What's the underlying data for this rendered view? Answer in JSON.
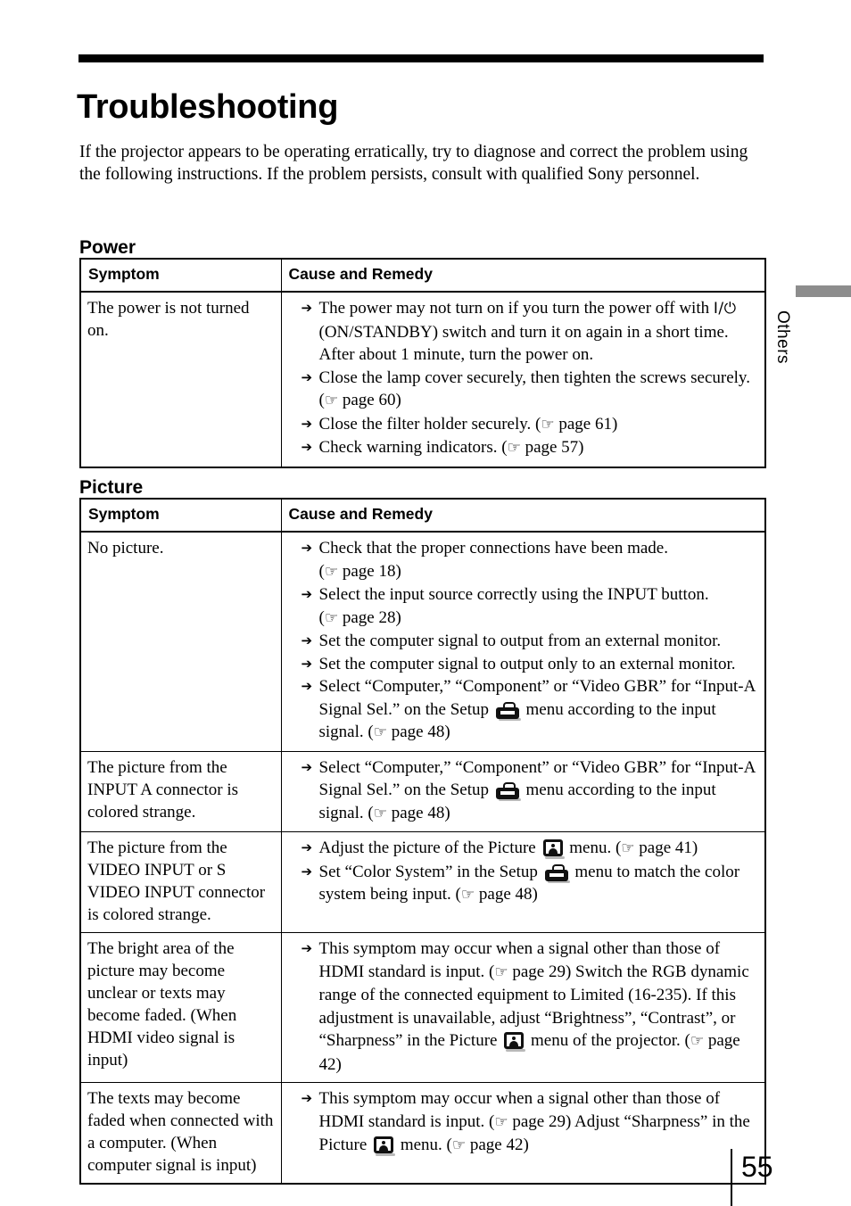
{
  "document": {
    "title": "Troubleshooting",
    "intro": "If the projector appears to be operating erratically, try to diagnose and correct the problem using the following instructions. If the problem persists, consult with qualified Sony personnel.",
    "page_number": "55",
    "side_tab": "Others"
  },
  "table_headers": {
    "symptom": "Symptom",
    "cause_and_remedy": "Cause and Remedy"
  },
  "sections": [
    {
      "heading": "Power",
      "rows": [
        {
          "symptom": "The power is not turned on.",
          "remedies": [
            {
              "parts": [
                {
                  "t": "text",
                  "v": "The power may not turn on if you turn the power off with "
                },
                {
                  "t": "power-symbol",
                  "v": "I/⏻"
                },
                {
                  "t": "text",
                  "v": " (ON/STANDBY) switch and turn it on again in a short time. After about 1 minute, turn the power on."
                }
              ]
            },
            {
              "parts": [
                {
                  "t": "text",
                  "v": "Close the lamp cover securely, then tighten the screws securely. ("
                },
                {
                  "t": "hand-icon",
                  "v": "☞"
                },
                {
                  "t": "text",
                  "v": " page 60)"
                }
              ]
            },
            {
              "parts": [
                {
                  "t": "text",
                  "v": "Close the filter holder securely. ("
                },
                {
                  "t": "hand-icon",
                  "v": "☞"
                },
                {
                  "t": "text",
                  "v": " page 61)"
                }
              ]
            },
            {
              "parts": [
                {
                  "t": "text",
                  "v": "Check warning indicators. ("
                },
                {
                  "t": "hand-icon",
                  "v": "☞"
                },
                {
                  "t": "text",
                  "v": " page 57)"
                }
              ]
            }
          ]
        }
      ]
    },
    {
      "heading": "Picture",
      "rows": [
        {
          "symptom": "No picture.",
          "remedies": [
            {
              "parts": [
                {
                  "t": "text",
                  "v": "Check that the proper connections have been made."
                },
                {
                  "t": "break",
                  "v": ""
                },
                {
                  "t": "text",
                  "v": " ("
                },
                {
                  "t": "hand-icon",
                  "v": "☞"
                },
                {
                  "t": "text",
                  "v": " page 18)"
                }
              ]
            },
            {
              "parts": [
                {
                  "t": "text",
                  "v": "Select the input source correctly using the INPUT button."
                },
                {
                  "t": "break",
                  "v": ""
                },
                {
                  "t": "text",
                  "v": " ("
                },
                {
                  "t": "hand-icon",
                  "v": "☞"
                },
                {
                  "t": "text",
                  "v": " page 28)"
                }
              ]
            },
            {
              "parts": [
                {
                  "t": "text",
                  "v": "Set the computer signal to output from an external monitor."
                }
              ]
            },
            {
              "parts": [
                {
                  "t": "text",
                  "v": "Set the computer signal to output only to an external monitor."
                }
              ]
            },
            {
              "parts": [
                {
                  "t": "text",
                  "v": "Select “Computer,” “Component” or “Video GBR” for “Input-A Signal Sel.” on the Setup "
                },
                {
                  "t": "setup-icon",
                  "v": ""
                },
                {
                  "t": "text",
                  "v": " menu according to the input signal. ("
                },
                {
                  "t": "hand-icon",
                  "v": "☞"
                },
                {
                  "t": "text",
                  "v": " page 48)"
                }
              ]
            }
          ]
        },
        {
          "symptom": "The picture from the INPUT A connector is colored strange.",
          "remedies": [
            {
              "parts": [
                {
                  "t": "text",
                  "v": "Select “Computer,” “Component” or “Video GBR” for “Input-A Signal Sel.” on the Setup "
                },
                {
                  "t": "setup-icon",
                  "v": ""
                },
                {
                  "t": "text",
                  "v": " menu according to the input signal. ("
                },
                {
                  "t": "hand-icon",
                  "v": "☞"
                },
                {
                  "t": "text",
                  "v": " page 48)"
                }
              ]
            }
          ]
        },
        {
          "symptom": "The picture from the VIDEO INPUT or S VIDEO INPUT connector is colored strange.",
          "remedies": [
            {
              "parts": [
                {
                  "t": "text",
                  "v": "Adjust the picture of the Picture "
                },
                {
                  "t": "picture-icon",
                  "v": ""
                },
                {
                  "t": "text",
                  "v": " menu. ("
                },
                {
                  "t": "hand-icon",
                  "v": "☞"
                },
                {
                  "t": "text",
                  "v": " page 41)"
                }
              ]
            },
            {
              "parts": [
                {
                  "t": "text",
                  "v": "Set “Color System” in the Setup "
                },
                {
                  "t": "setup-icon",
                  "v": ""
                },
                {
                  "t": "text",
                  "v": " menu to match the color system being input. ("
                },
                {
                  "t": "hand-icon",
                  "v": "☞"
                },
                {
                  "t": "text",
                  "v": " page 48)"
                }
              ]
            }
          ]
        },
        {
          "symptom": "The bright area of the picture may become unclear or texts may become faded. (When HDMI video signal is input)",
          "remedies": [
            {
              "parts": [
                {
                  "t": "text",
                  "v": "This symptom may occur when a signal other than those of HDMI standard is input. ("
                },
                {
                  "t": "hand-icon",
                  "v": "☞"
                },
                {
                  "t": "text",
                  "v": " page 29) Switch the RGB dynamic range of the connected equipment to Limited (16-235). If this adjustment is unavailable, adjust “Brightness”, “Contrast”, or “Sharpness” in the Picture "
                },
                {
                  "t": "picture-icon",
                  "v": ""
                },
                {
                  "t": "text",
                  "v": " menu of the projector. ("
                },
                {
                  "t": "hand-icon",
                  "v": "☞"
                },
                {
                  "t": "text",
                  "v": " page 42)"
                }
              ]
            }
          ]
        },
        {
          "symptom": "The texts may become faded when connected with a computer. (When computer signal is input)",
          "remedies": [
            {
              "parts": [
                {
                  "t": "text",
                  "v": "This symptom may occur when a signal other than those of HDMI standard is input. ("
                },
                {
                  "t": "hand-icon",
                  "v": "☞"
                },
                {
                  "t": "text",
                  "v": " page 29) Adjust “Sharpness” in the Picture "
                },
                {
                  "t": "picture-icon",
                  "v": ""
                },
                {
                  "t": "text",
                  "v": " menu. ("
                },
                {
                  "t": "hand-icon",
                  "v": "☞"
                },
                {
                  "t": "text",
                  "v": " page 42)"
                }
              ]
            }
          ]
        }
      ]
    }
  ],
  "bullet_arrow": "➔",
  "colors": {
    "text": "#000000",
    "rule": "#000000",
    "side_tab_bar": "#8d8d8d",
    "icon_shadow": "#b9b9b9"
  }
}
